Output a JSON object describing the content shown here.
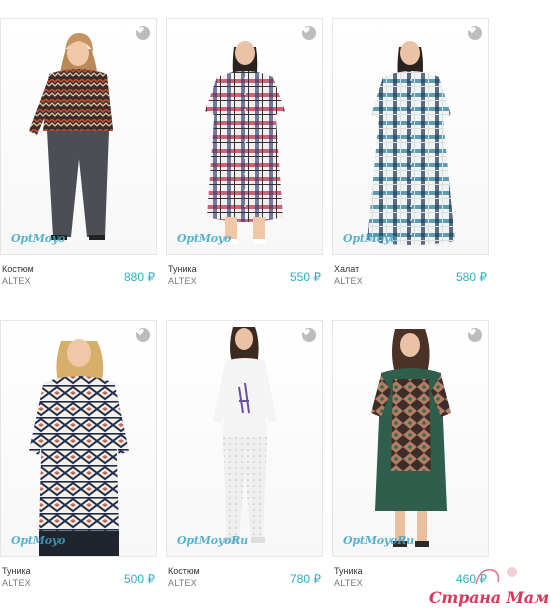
{
  "colors": {
    "price": "#2ab2c6",
    "favorite_icon_bg": "#bdbdbd",
    "watermark": "#3aa6c9",
    "site_logo": "#d93a5b"
  },
  "products": [
    {
      "name": "Костюм",
      "brand": "ALTEX",
      "price": "880 ₽",
      "watermark": "OptMoyo",
      "favorite_icon": "heart-icon"
    },
    {
      "name": "Туника",
      "brand": "ALTEX",
      "price": "550 ₽",
      "watermark": "OptMoyo",
      "favorite_icon": "heart-icon"
    },
    {
      "name": "Халат",
      "brand": "ALTEX",
      "price": "580 ₽",
      "watermark": "OptMoyo",
      "favorite_icon": "heart-icon"
    },
    {
      "name": "Туника",
      "brand": "ALTEX",
      "price": "500 ₽",
      "watermark": "OptMoyo",
      "favorite_icon": "heart-icon"
    },
    {
      "name": "Костюм",
      "brand": "ALTEX",
      "price": "780 ₽",
      "watermark": "OptMoyoRu",
      "favorite_icon": "heart-icon"
    },
    {
      "name": "Туника",
      "brand": "ALTEX",
      "price": "460 ₽",
      "watermark": "OptMoyoRu",
      "favorite_icon": "heart-icon"
    }
  ],
  "site_watermark": "Страна Мам"
}
